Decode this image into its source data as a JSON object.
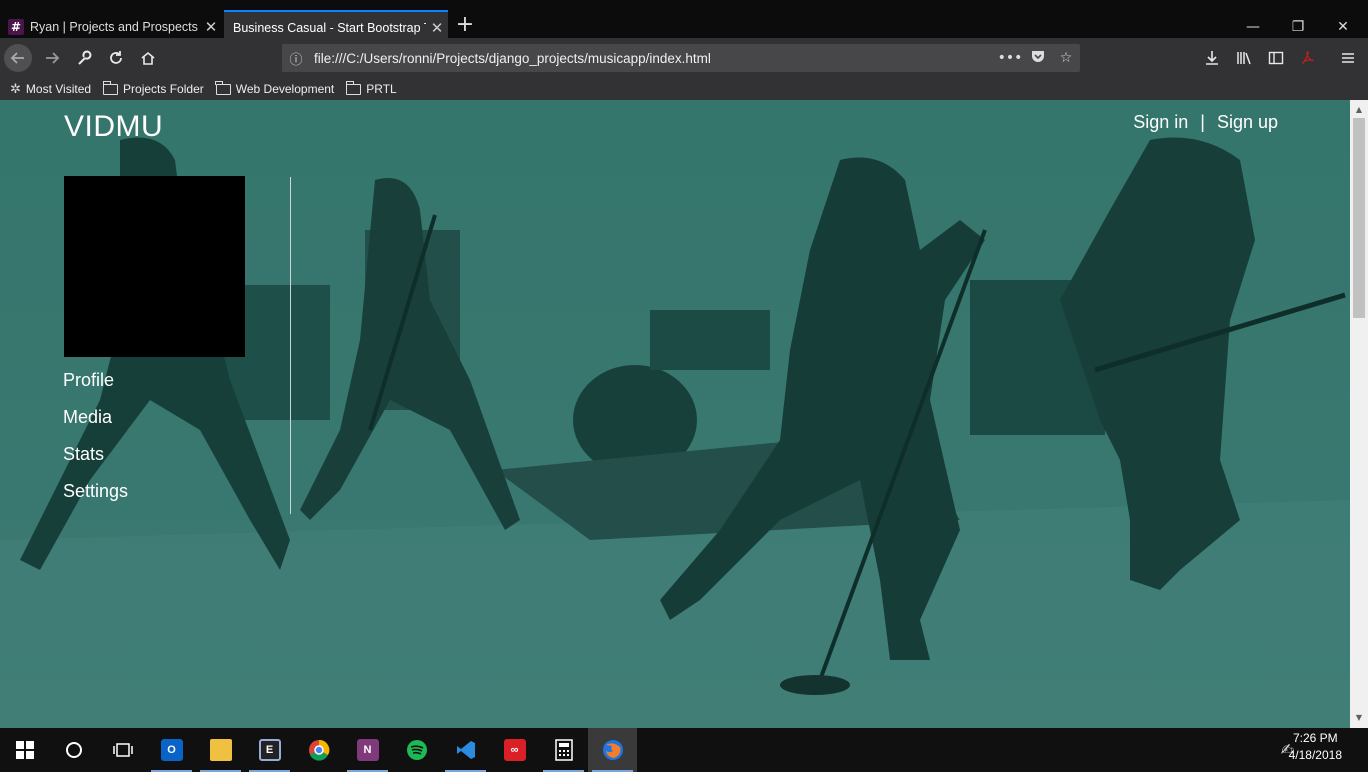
{
  "browser": {
    "tabs": [
      {
        "favicon": "#",
        "title": "Ryan | Projects and Prospects S",
        "active": false
      },
      {
        "title": "Business Casual - Start Bootstrap Th",
        "active": true
      }
    ],
    "new_tab_icon": "+",
    "window_controls": {
      "minimize": "—",
      "maximize": "❐",
      "close": "✕"
    },
    "url": "file:///C:/Users/ronni/Projects/django_projects/musicapp/index.html",
    "bookmarks": [
      "Most Visited",
      "Projects Folder",
      "Web Development",
      "PRTL"
    ]
  },
  "site": {
    "brand": "VIDMU",
    "auth": {
      "sign_in": "Sign in",
      "separator": "|",
      "sign_up": "Sign up"
    },
    "menu": [
      "Profile",
      "Media",
      "Stats",
      "Settings"
    ],
    "overlay_color": "#2f6e66"
  },
  "taskbar": {
    "apps": [
      "start",
      "cortana",
      "task-view",
      "outlook",
      "file-explorer",
      "visual-studio",
      "chrome",
      "onenote",
      "spotify",
      "vscode",
      "creative-cloud",
      "calculator",
      "firefox"
    ],
    "time": "7:26 PM",
    "date": "4/18/2018"
  }
}
